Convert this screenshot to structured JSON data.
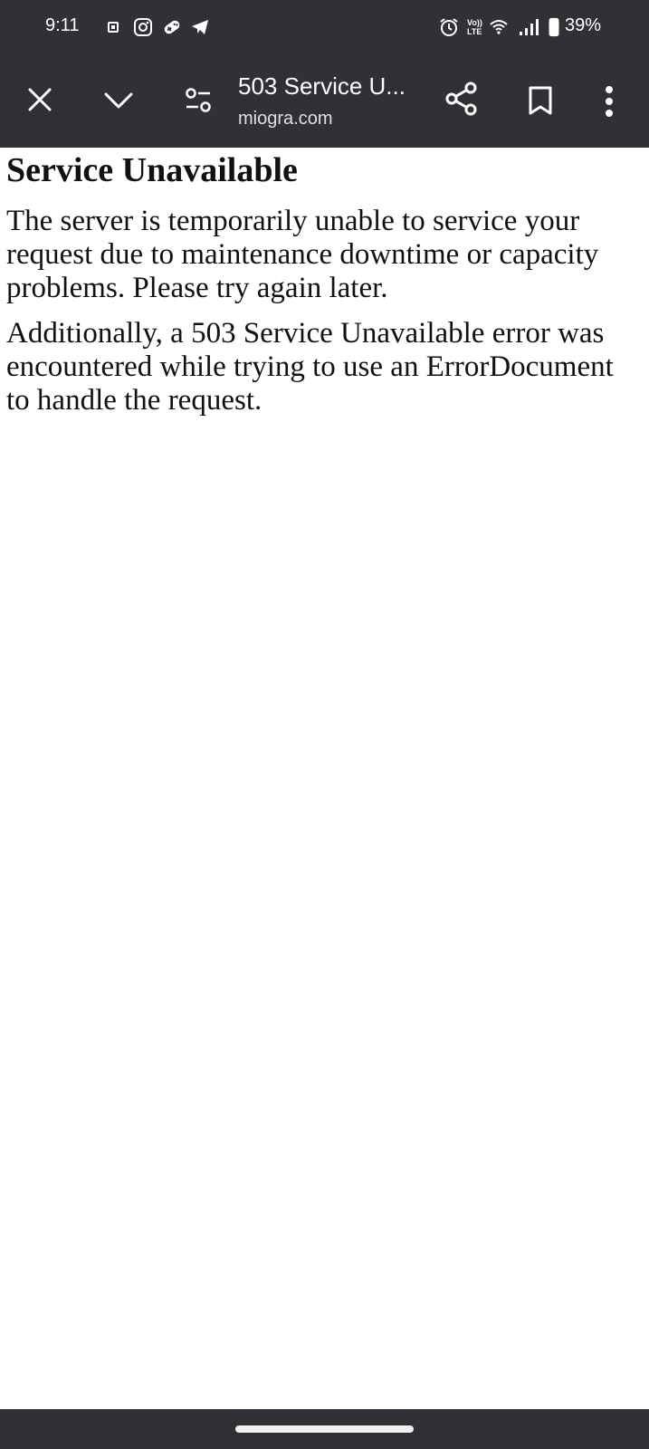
{
  "status_bar": {
    "time": "9:11",
    "battery_percent": "39%",
    "notification_icons": [
      "notification-icon",
      "instagram-icon",
      "game-controller-icon",
      "telegram-icon"
    ],
    "system_icons": [
      "alarm-icon",
      "volte-icon",
      "wifi-icon",
      "signal-icon",
      "battery-icon"
    ],
    "volte_label": "Vo)) LTE",
    "battery_level": 0.39
  },
  "toolbar": {
    "page_title": "503 Service U...",
    "url": "miogra.com",
    "icons": [
      "close-icon",
      "chevron-down-icon",
      "page-info-icon",
      "share-icon",
      "bookmark-icon",
      "more-options-icon"
    ]
  },
  "page": {
    "heading": "Service Unavailable",
    "paragraph_1": "The server is temporarily unable to service your request due to maintenance downtime or capacity problems. Please try again later.",
    "paragraph_2": "Additionally, a 503 Service Unavailable error was encountered while trying to use an ErrorDocument to handle the request."
  },
  "colors": {
    "chrome_background": "#303134",
    "page_background": "#ffffff",
    "text": "#111111"
  }
}
